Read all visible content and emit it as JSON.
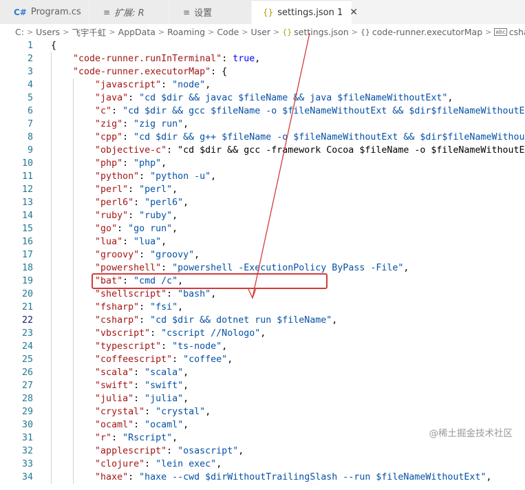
{
  "tabs": [
    {
      "icon": "C#",
      "label": "Program.cs",
      "active": false
    },
    {
      "icon": "≡",
      "label": "扩展: R",
      "active": false
    },
    {
      "icon": "≡",
      "label": "设置",
      "active": false
    },
    {
      "icon": "{}",
      "label": "settings.json 1",
      "active": true,
      "close": "✕"
    }
  ],
  "breadcrumb": [
    "C:",
    "Users",
    "飞宇千虹",
    "AppData",
    "Roaming",
    "Code",
    "User"
  ],
  "breadcrumb_file": {
    "icon": "{}",
    "label": "settings.json"
  },
  "breadcrumb_obj": {
    "icon": "{}",
    "label": "code-runner.executorMap"
  },
  "breadcrumb_key": {
    "icon": "abc",
    "label": "csharp"
  },
  "lines": [
    {
      "n": "1",
      "t": "{"
    },
    {
      "n": "2",
      "t": "    \"code-runner.runInTerminal\": true,"
    },
    {
      "n": "3",
      "t": "    \"code-runner.executorMap\": {"
    },
    {
      "n": "4",
      "t": "        \"javascript\": \"node\","
    },
    {
      "n": "5",
      "t": "        \"java\": \"cd $dir && javac $fileName && java $fileNameWithoutExt\","
    },
    {
      "n": "6",
      "t": "        \"c\": \"cd $dir && gcc $fileName -o $fileNameWithoutExt && $dir$fileNameWithoutExt\","
    },
    {
      "n": "7",
      "t": "        \"zig\": \"zig run\","
    },
    {
      "n": "8",
      "t": "        \"cpp\": \"cd $dir && g++ $fileName -o $fileNameWithoutExt && $dir$fileNameWithoutExt\","
    },
    {
      "n": "9",
      "t": "        \"objective-c\": \"cd $dir && gcc -framework Cocoa $fileName -o $fileNameWithoutExt &&"
    },
    {
      "n": "10",
      "t": "        \"php\": \"php\","
    },
    {
      "n": "11",
      "t": "        \"python\": \"python -u\","
    },
    {
      "n": "12",
      "t": "        \"perl\": \"perl\","
    },
    {
      "n": "13",
      "t": "        \"perl6\": \"perl6\","
    },
    {
      "n": "14",
      "t": "        \"ruby\": \"ruby\","
    },
    {
      "n": "15",
      "t": "        \"go\": \"go run\","
    },
    {
      "n": "16",
      "t": "        \"lua\": \"lua\","
    },
    {
      "n": "17",
      "t": "        \"groovy\": \"groovy\","
    },
    {
      "n": "18",
      "t": "        \"powershell\": \"powershell -ExecutionPolicy ByPass -File\","
    },
    {
      "n": "19",
      "t": "        \"bat\": \"cmd /c\","
    },
    {
      "n": "20",
      "t": "        \"shellscript\": \"bash\","
    },
    {
      "n": "21",
      "t": "        \"fsharp\": \"fsi\","
    },
    {
      "n": "22",
      "t": "        \"csharp\": \"cd $dir && dotnet run $fileName\","
    },
    {
      "n": "23",
      "t": "        \"vbscript\": \"cscript //Nologo\","
    },
    {
      "n": "24",
      "t": "        \"typescript\": \"ts-node\","
    },
    {
      "n": "25",
      "t": "        \"coffeescript\": \"coffee\","
    },
    {
      "n": "26",
      "t": "        \"scala\": \"scala\","
    },
    {
      "n": "27",
      "t": "        \"swift\": \"swift\","
    },
    {
      "n": "28",
      "t": "        \"julia\": \"julia\","
    },
    {
      "n": "29",
      "t": "        \"crystal\": \"crystal\","
    },
    {
      "n": "30",
      "t": "        \"ocaml\": \"ocaml\","
    },
    {
      "n": "31",
      "t": "        \"r\": \"Rscript\","
    },
    {
      "n": "32",
      "t": "        \"applescript\": \"osascript\","
    },
    {
      "n": "33",
      "t": "        \"clojure\": \"lein exec\","
    },
    {
      "n": "34",
      "t": "        \"haxe\": \"haxe --cwd $dirWithoutTrailingSlash --run $fileNameWithoutExt\","
    }
  ],
  "current_line": "22",
  "watermark": "@稀土掘金技术社区",
  "colors": {
    "key": "#a31515",
    "string": "#0451a5",
    "bool": "#0000ff",
    "annotation": "#d33a3a"
  }
}
